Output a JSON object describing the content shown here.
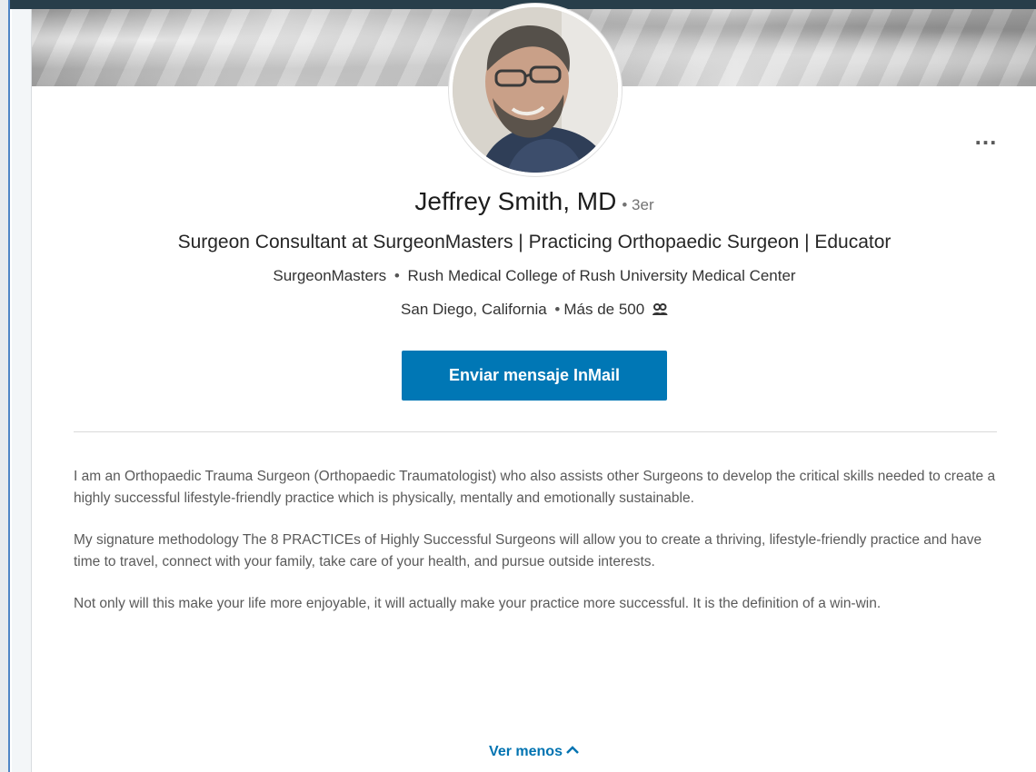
{
  "profile": {
    "name": "Jeffrey Smith, MD",
    "degree": "• 3er",
    "headline": "Surgeon Consultant at SurgeonMasters | Practicing Orthopaedic Surgeon | Educator",
    "company": "SurgeonMasters",
    "school": "Rush Medical College of Rush University Medical Center",
    "location": "San Diego, California",
    "connections": "Más de 500",
    "separator": "•"
  },
  "actions": {
    "inmail_label": "Enviar mensaje InMail",
    "more_label": "..."
  },
  "summary": {
    "paragraphs": [
      "I am an Orthopaedic Trauma Surgeon (Orthopaedic Traumatologist) who also assists other Surgeons to develop the critical skills needed to create a highly successful lifestyle-friendly practice which is physically, mentally and emotionally sustainable.",
      "My signature methodology The 8 PRACTICEs of Highly Successful Surgeons will allow you to create a thriving, lifestyle-friendly practice and have time to travel, connect with your family, take care of your health, and pursue outside interests.",
      "Not only will this make your life more enjoyable, it will actually make your practice more successful. It is the definition of a win-win."
    ],
    "toggle_label": "Ver menos"
  },
  "colors": {
    "brand_button": "#0077b5",
    "link": "#0073b1",
    "top_bar": "#283e4a"
  },
  "icons": {
    "connections": "people-icon",
    "toggle": "chevron-up-icon",
    "more": "ellipsis-icon"
  }
}
